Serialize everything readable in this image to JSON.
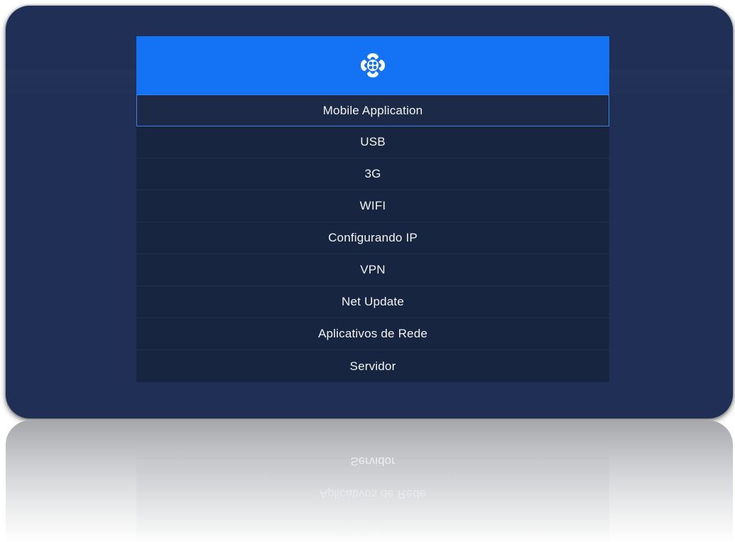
{
  "menu": {
    "logo_icon": "flower-logo-icon",
    "items": [
      {
        "label": "Mobile Application",
        "selected": true
      },
      {
        "label": "USB"
      },
      {
        "label": "3G"
      },
      {
        "label": "WIFI"
      },
      {
        "label": "Configurando IP"
      },
      {
        "label": "VPN"
      },
      {
        "label": "Net Update"
      },
      {
        "label": "Aplicativos de Rede"
      },
      {
        "label": "Servidor"
      }
    ]
  },
  "colors": {
    "background": "#1f2f55",
    "header": "#1473f5",
    "item_bg": "#182540",
    "selection_border": "#3d82e6",
    "text": "#f2f4f8"
  }
}
